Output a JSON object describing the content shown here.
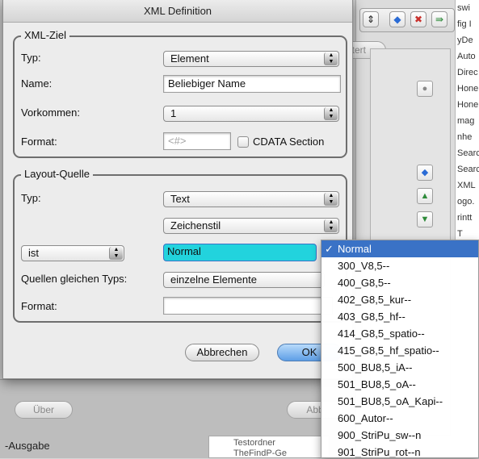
{
  "dialog": {
    "title": "XML Definition",
    "xml_ziel": {
      "title": "XML-Ziel",
      "typ_label": "Typ:",
      "typ_value": "Element",
      "name_label": "Name:",
      "name_value": "Beliebiger Name",
      "vorkommen_label": "Vorkommen:",
      "vorkommen_value": "1",
      "format_label": "Format:",
      "format_placeholder": "<#>",
      "cdata_label": "CDATA Section"
    },
    "layout_quelle": {
      "title": "Layout-Quelle",
      "typ_label": "Typ:",
      "typ_value": "Text",
      "zeichenstil_value": "Zeichenstil",
      "condition_value": "ist",
      "style_value": "Normal",
      "quellen_label": "Quellen gleichen Typs:",
      "quellen_value": "einzelne Elemente",
      "format_label": "Format:"
    },
    "buttons": {
      "cancel": "Abbrechen",
      "ok": "OK"
    }
  },
  "menu": {
    "items": [
      {
        "label": "Normal",
        "selected": true
      },
      {
        "label": "300_V8,5--",
        "selected": false
      },
      {
        "label": "400_G8,5--",
        "selected": false
      },
      {
        "label": "402_G8,5_kur--",
        "selected": false
      },
      {
        "label": "403_G8,5_hf--",
        "selected": false
      },
      {
        "label": "414_G8,5_spatio--",
        "selected": false
      },
      {
        "label": "415_G8,5_hf_spatio--",
        "selected": false
      },
      {
        "label": "500_BU8,5_iA--",
        "selected": false
      },
      {
        "label": "501_BU8,5_oA--",
        "selected": false
      },
      {
        "label": "501_BU8,5_oA_Kapi--",
        "selected": false
      },
      {
        "label": "600_Autor--",
        "selected": false
      },
      {
        "label": "900_StriPu_sw--n",
        "selected": false
      },
      {
        "label": "901_StriPu_rot--n",
        "selected": false
      }
    ],
    "check_mark": "✓"
  },
  "background": {
    "list_items": [
      "swi",
      "fig I",
      "yDe",
      "Auto",
      "Direc",
      "Hone",
      "Hone",
      "mag",
      "nhe",
      "Searc",
      "Searc",
      "XML",
      "ogo.",
      "rintt",
      "T"
    ],
    "filter_button": "ltert",
    "ueber_button": "Über",
    "abb_button": "Abb",
    "ausgabe_label": "-Ausgabe",
    "folder_label": "Testordner",
    "folder_label_2": "TheFindP-Ge"
  },
  "colors": {
    "selection_cyan": "#22d3dd",
    "menu_highlight": "#3a72c6",
    "default_button": "#5e9ee6"
  }
}
